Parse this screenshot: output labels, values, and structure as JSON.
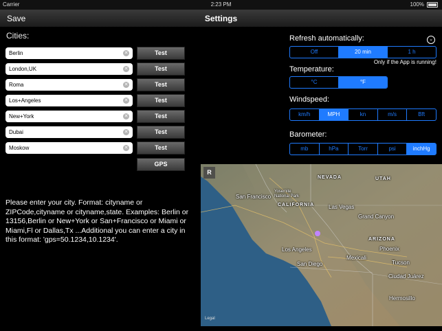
{
  "status_bar": {
    "carrier": "Carrier",
    "time": "2:23 PM",
    "battery": "100%"
  },
  "nav": {
    "save": "Save",
    "title": "Settings"
  },
  "cities": {
    "label": "Cities:",
    "items": [
      {
        "value": "Berlin",
        "test": "Test"
      },
      {
        "value": "London,UK",
        "test": "Test"
      },
      {
        "value": "Roma",
        "test": "Test"
      },
      {
        "value": "Los+Angeles",
        "test": "Test"
      },
      {
        "value": "New+York",
        "test": "Test"
      },
      {
        "value": "Dubai",
        "test": "Test"
      },
      {
        "value": "Moskow",
        "test": "Test"
      }
    ],
    "gps": "GPS",
    "help": "Please enter your city. Format: cityname  or ZIPCode,cityname or cityname,state. Examples: Berlin or 13156,Berlin or New+York or San+Francisco or Miami or Miami,Fl or Dallas,Tx ...Additional you can enter a city in this format: 'gps=50.1234,10.1234'."
  },
  "refresh": {
    "label": "Refresh automatically:",
    "options": [
      "Off",
      "20 min",
      "1 h"
    ],
    "selected": "20 min",
    "note": "Only if the App is running!"
  },
  "temperature": {
    "label": "Temperature:",
    "options": [
      "°C",
      "°F"
    ],
    "selected": "°F"
  },
  "windspeed": {
    "label": "Windspeed:",
    "options": [
      "km/h",
      "MPH",
      "kn",
      "m/s",
      "Bft"
    ],
    "selected": "MPH"
  },
  "barometer": {
    "label": "Barometer:",
    "options": [
      "mb",
      "hPa",
      "Torr",
      "psi",
      "inchHg"
    ],
    "selected": "inchHg"
  },
  "map": {
    "r_button": "R",
    "legal": "Legal",
    "labels": {
      "nevada": "NEVADA",
      "utah": "UTAH",
      "california": "CALIFORNIA",
      "arizona": "ARIZONA",
      "san_francisco": "San Francisco",
      "yosemite": "Yosemite\nNational Park",
      "las_vegas": "Las Vegas",
      "grand_canyon": "Grand Canyon",
      "los_angeles": "Los Angeles",
      "san_diego": "San Diego",
      "mexicali": "Mexicali",
      "phoenix": "Phoenix",
      "tucson": "Tucson",
      "ciudad_juarez": "Ciudad Juárez",
      "hermosillo": "Hermosillo"
    },
    "colors": {
      "ocean": "#2e5f86",
      "land": "#8a8a74",
      "pin": "#c084ff"
    }
  },
  "colors": {
    "accent": "#1f7bff",
    "background": "#000000"
  }
}
